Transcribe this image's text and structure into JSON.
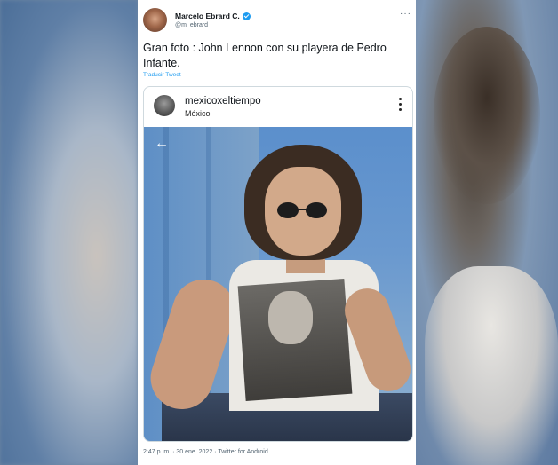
{
  "tweet": {
    "display_name": "Marcelo Ebrard C.",
    "handle": "@m_ebrard",
    "more_icon": "more-icon",
    "text": "Gran foto : John Lennon con su playera de Pedro Infante.",
    "translate_label": "Traducir Tweet",
    "timestamp": "2:47 p. m. · 30 ene. 2022 · Twitter for Android"
  },
  "embed": {
    "username": "mexicoxeltiempo",
    "location": "México"
  },
  "colors": {
    "accent": "#1d9bf0",
    "text": "#0f1419",
    "muted": "#536471"
  }
}
